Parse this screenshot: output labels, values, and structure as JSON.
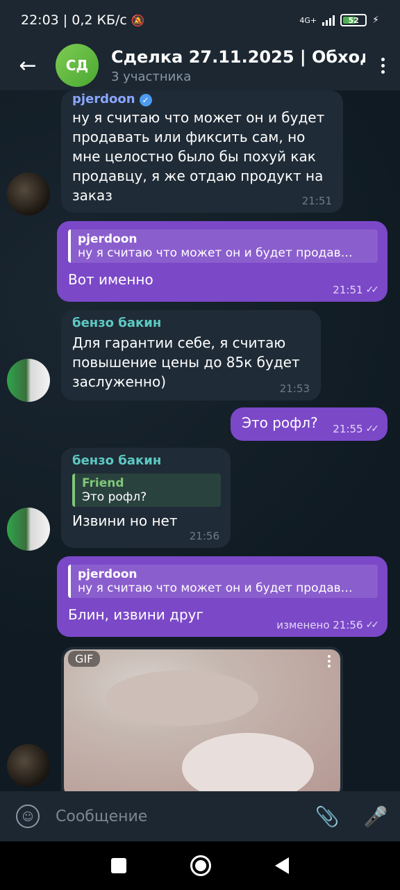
{
  "status_bar": {
    "time_speed": "22:03 | 0,2 КБ/с",
    "network": "4G+",
    "battery": "52"
  },
  "header": {
    "avatar_initials": "СД",
    "title": "Сделка 27.11.2025 | Обход",
    "subtitle": "3 участника"
  },
  "messages": [
    {
      "sender": "pjerdoon",
      "text": "ну я считаю что может он и будет продавать или фиксить сам, но мне целостно было бы похуй как продавцу, я же отдаю продукт на заказ",
      "time": "21:51"
    },
    {
      "reply_name": "pjerdoon",
      "reply_text": "ну я считаю что может он и будет продав…",
      "text": "Вот именно",
      "time": "21:51"
    },
    {
      "sender": "бензо бакин",
      "text": "Для гарантии себе, я считаю повышение цены до 85к будет заслуженно)",
      "time": "21:53"
    },
    {
      "text": "Это рофл?",
      "time": "21:55"
    },
    {
      "sender": "бензо бакин",
      "reply_name": "Friend",
      "reply_text": "Это рофл?",
      "text": "Извини но нет",
      "time": "21:56"
    },
    {
      "reply_name": "pjerdoon",
      "reply_text": "ну я считаю что может он и будет продав…",
      "text": "Блин, извини друг",
      "time": "изменено 21:56"
    }
  ],
  "gif": {
    "badge": "GIF"
  },
  "input": {
    "placeholder": "Сообщение"
  },
  "ticks": "✓✓"
}
